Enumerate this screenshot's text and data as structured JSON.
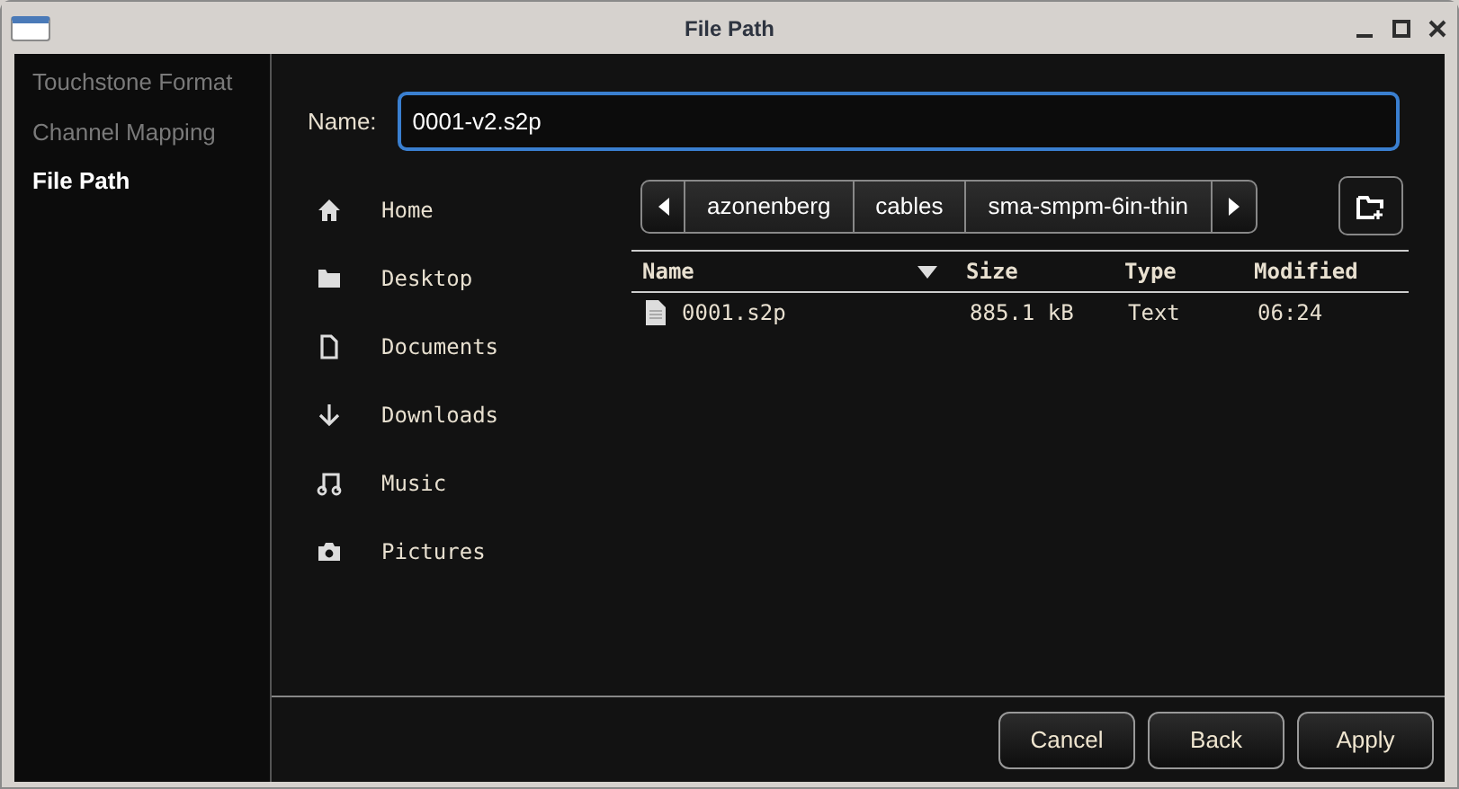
{
  "window": {
    "title": "File Path"
  },
  "steps": [
    {
      "label": "Touchstone Format",
      "selected": false
    },
    {
      "label": "Channel Mapping",
      "selected": false
    },
    {
      "label": "File Path",
      "selected": true
    }
  ],
  "name_field": {
    "label": "Name:",
    "value": "0001-v2.s2p"
  },
  "places": [
    {
      "kind": "home",
      "label": "Home"
    },
    {
      "kind": "folder",
      "label": "Desktop"
    },
    {
      "kind": "document",
      "label": "Documents"
    },
    {
      "kind": "download",
      "label": "Downloads"
    },
    {
      "kind": "music",
      "label": "Music"
    },
    {
      "kind": "camera",
      "label": "Pictures"
    }
  ],
  "path": [
    "azonenberg",
    "cables",
    "sma-smpm-6in-thin"
  ],
  "table": {
    "columns": [
      "Name",
      "Size",
      "Type",
      "Modified"
    ],
    "rows": [
      {
        "name": "0001.s2p",
        "size": "885.1 kB",
        "type": "Text",
        "modified": "06:24"
      }
    ]
  },
  "buttons": [
    "Cancel",
    "Back",
    "Apply"
  ]
}
